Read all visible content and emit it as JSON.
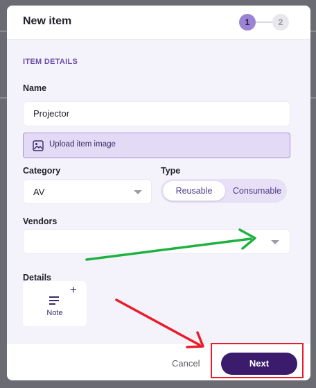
{
  "dialog": {
    "title": "New item",
    "steps": [
      "1",
      "2"
    ],
    "current_step": 1
  },
  "form": {
    "section_heading": "ITEM DETAILS",
    "name": {
      "label": "Name",
      "value": "Projector"
    },
    "upload": {
      "label": "Upload item image",
      "icon": "image-icon"
    },
    "category": {
      "label": "Category",
      "value": "AV"
    },
    "type": {
      "label": "Type",
      "options": [
        "Reusable",
        "Consumable"
      ],
      "selected": "Reusable"
    },
    "vendors": {
      "label": "Vendors",
      "value": ""
    },
    "details": {
      "label": "Details",
      "note_label": "Note",
      "add_icon": "plus-icon",
      "note_icon": "note-lines-icon"
    }
  },
  "footer": {
    "cancel_label": "Cancel",
    "next_label": "Next"
  },
  "annotations": {
    "arrow_green_color": "#1db23f",
    "arrow_red_color": "#e81c2a",
    "highlight_color": "#e81c2a"
  },
  "colors": {
    "accent": "#3b1b6c",
    "step_active": "#9c83d3",
    "section_heading": "#6a4fa8"
  }
}
